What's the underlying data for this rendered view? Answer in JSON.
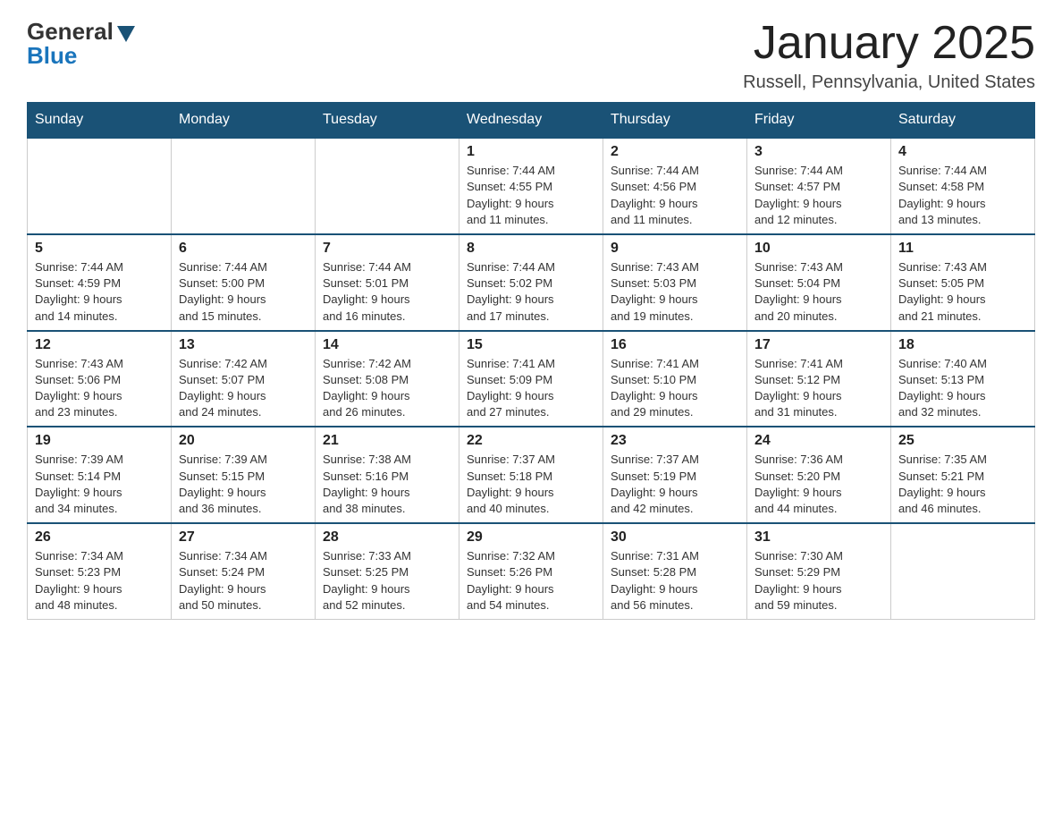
{
  "logo": {
    "general": "General",
    "blue": "Blue"
  },
  "title": "January 2025",
  "subtitle": "Russell, Pennsylvania, United States",
  "headers": [
    "Sunday",
    "Monday",
    "Tuesday",
    "Wednesday",
    "Thursday",
    "Friday",
    "Saturday"
  ],
  "weeks": [
    [
      {
        "day": "",
        "info": ""
      },
      {
        "day": "",
        "info": ""
      },
      {
        "day": "",
        "info": ""
      },
      {
        "day": "1",
        "info": "Sunrise: 7:44 AM\nSunset: 4:55 PM\nDaylight: 9 hours\nand 11 minutes."
      },
      {
        "day": "2",
        "info": "Sunrise: 7:44 AM\nSunset: 4:56 PM\nDaylight: 9 hours\nand 11 minutes."
      },
      {
        "day": "3",
        "info": "Sunrise: 7:44 AM\nSunset: 4:57 PM\nDaylight: 9 hours\nand 12 minutes."
      },
      {
        "day": "4",
        "info": "Sunrise: 7:44 AM\nSunset: 4:58 PM\nDaylight: 9 hours\nand 13 minutes."
      }
    ],
    [
      {
        "day": "5",
        "info": "Sunrise: 7:44 AM\nSunset: 4:59 PM\nDaylight: 9 hours\nand 14 minutes."
      },
      {
        "day": "6",
        "info": "Sunrise: 7:44 AM\nSunset: 5:00 PM\nDaylight: 9 hours\nand 15 minutes."
      },
      {
        "day": "7",
        "info": "Sunrise: 7:44 AM\nSunset: 5:01 PM\nDaylight: 9 hours\nand 16 minutes."
      },
      {
        "day": "8",
        "info": "Sunrise: 7:44 AM\nSunset: 5:02 PM\nDaylight: 9 hours\nand 17 minutes."
      },
      {
        "day": "9",
        "info": "Sunrise: 7:43 AM\nSunset: 5:03 PM\nDaylight: 9 hours\nand 19 minutes."
      },
      {
        "day": "10",
        "info": "Sunrise: 7:43 AM\nSunset: 5:04 PM\nDaylight: 9 hours\nand 20 minutes."
      },
      {
        "day": "11",
        "info": "Sunrise: 7:43 AM\nSunset: 5:05 PM\nDaylight: 9 hours\nand 21 minutes."
      }
    ],
    [
      {
        "day": "12",
        "info": "Sunrise: 7:43 AM\nSunset: 5:06 PM\nDaylight: 9 hours\nand 23 minutes."
      },
      {
        "day": "13",
        "info": "Sunrise: 7:42 AM\nSunset: 5:07 PM\nDaylight: 9 hours\nand 24 minutes."
      },
      {
        "day": "14",
        "info": "Sunrise: 7:42 AM\nSunset: 5:08 PM\nDaylight: 9 hours\nand 26 minutes."
      },
      {
        "day": "15",
        "info": "Sunrise: 7:41 AM\nSunset: 5:09 PM\nDaylight: 9 hours\nand 27 minutes."
      },
      {
        "day": "16",
        "info": "Sunrise: 7:41 AM\nSunset: 5:10 PM\nDaylight: 9 hours\nand 29 minutes."
      },
      {
        "day": "17",
        "info": "Sunrise: 7:41 AM\nSunset: 5:12 PM\nDaylight: 9 hours\nand 31 minutes."
      },
      {
        "day": "18",
        "info": "Sunrise: 7:40 AM\nSunset: 5:13 PM\nDaylight: 9 hours\nand 32 minutes."
      }
    ],
    [
      {
        "day": "19",
        "info": "Sunrise: 7:39 AM\nSunset: 5:14 PM\nDaylight: 9 hours\nand 34 minutes."
      },
      {
        "day": "20",
        "info": "Sunrise: 7:39 AM\nSunset: 5:15 PM\nDaylight: 9 hours\nand 36 minutes."
      },
      {
        "day": "21",
        "info": "Sunrise: 7:38 AM\nSunset: 5:16 PM\nDaylight: 9 hours\nand 38 minutes."
      },
      {
        "day": "22",
        "info": "Sunrise: 7:37 AM\nSunset: 5:18 PM\nDaylight: 9 hours\nand 40 minutes."
      },
      {
        "day": "23",
        "info": "Sunrise: 7:37 AM\nSunset: 5:19 PM\nDaylight: 9 hours\nand 42 minutes."
      },
      {
        "day": "24",
        "info": "Sunrise: 7:36 AM\nSunset: 5:20 PM\nDaylight: 9 hours\nand 44 minutes."
      },
      {
        "day": "25",
        "info": "Sunrise: 7:35 AM\nSunset: 5:21 PM\nDaylight: 9 hours\nand 46 minutes."
      }
    ],
    [
      {
        "day": "26",
        "info": "Sunrise: 7:34 AM\nSunset: 5:23 PM\nDaylight: 9 hours\nand 48 minutes."
      },
      {
        "day": "27",
        "info": "Sunrise: 7:34 AM\nSunset: 5:24 PM\nDaylight: 9 hours\nand 50 minutes."
      },
      {
        "day": "28",
        "info": "Sunrise: 7:33 AM\nSunset: 5:25 PM\nDaylight: 9 hours\nand 52 minutes."
      },
      {
        "day": "29",
        "info": "Sunrise: 7:32 AM\nSunset: 5:26 PM\nDaylight: 9 hours\nand 54 minutes."
      },
      {
        "day": "30",
        "info": "Sunrise: 7:31 AM\nSunset: 5:28 PM\nDaylight: 9 hours\nand 56 minutes."
      },
      {
        "day": "31",
        "info": "Sunrise: 7:30 AM\nSunset: 5:29 PM\nDaylight: 9 hours\nand 59 minutes."
      },
      {
        "day": "",
        "info": ""
      }
    ]
  ]
}
